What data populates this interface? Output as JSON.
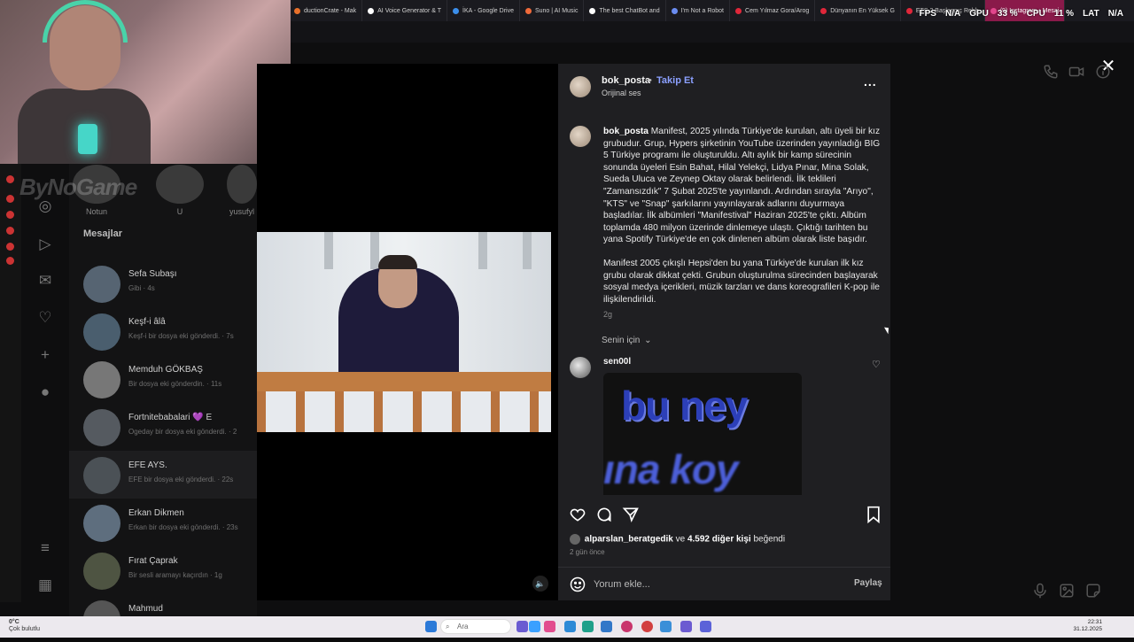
{
  "browser": {
    "tabs": [
      {
        "label": "ductionCrate - Mak",
        "color": "#e8702a"
      },
      {
        "label": "AI Voice Generator & T",
        "color": "#ffffff"
      },
      {
        "label": "İKA - Google Drive",
        "color": "#3b8eea"
      },
      {
        "label": "Suno | AI Music",
        "color": "#f06a3a"
      },
      {
        "label": "The best ChatBot and",
        "color": "#ffffff"
      },
      {
        "label": "I'm Not a Robot",
        "color": "#6a8cf0"
      },
      {
        "label": "Cem Yılmaz Gora/Arog",
        "color": "#e0273a"
      },
      {
        "label": "Dünyanın En Yüksek G",
        "color": "#e0273a"
      },
      {
        "label": "ETS 2 Başlangıç Rehb",
        "color": "#e0273a"
      },
      {
        "label": "(9) Instagram • Mesaj",
        "color": "#e2468c"
      }
    ]
  },
  "perf": {
    "fps_label": "FPS",
    "fps_value": "N/A",
    "gpu_label": "GPU",
    "gpu_value": "33 %",
    "cpu_label": "CPU",
    "cpu_value": "11 %",
    "lat_label": "LAT",
    "lat_value": "N/A"
  },
  "watermark": "ByNoGame",
  "stories": [
    {
      "name": "Notun"
    },
    {
      "name": "U"
    },
    {
      "name": "yusufyl"
    }
  ],
  "dm": {
    "title": "Mesajlar",
    "items": [
      {
        "name": "Sefa Subaşı",
        "preview": "Gibi · 4s"
      },
      {
        "name": "Keşf-i âlâ",
        "preview": "Keşf-i bir dosya eki gönderdi. · 7s"
      },
      {
        "name": "Memduh GÖKBAŞ",
        "preview": "Bir dosya eki gönderdin. · 11s"
      },
      {
        "name": "Fortnitebabalari 💜 E",
        "preview": "Ogeday bir dosya eki gönderdi. · 2"
      },
      {
        "name": "EFE AYS.",
        "preview": "EFE bir dosya eki gönderdi. · 22s"
      },
      {
        "name": "Erkan Dikmen",
        "preview": "Erkan bir dosya eki gönderdi. · 23s"
      },
      {
        "name": "Fırat Çaprak",
        "preview": "Bir sesli aramayı kaçırdın · 1g"
      },
      {
        "name": "Mahmud",
        "preview": ""
      }
    ]
  },
  "post": {
    "username": "bok_posta",
    "separator": "•",
    "follow": "Takip Et",
    "audio": "Orijinal ses",
    "more": "...",
    "caption_user": "bok_posta",
    "caption_p1": "Manifest, 2025 yılında Türkiye'de kurulan, altı üyeli bir kız grubudur. Grup, Hypers şirketinin YouTube üzerinden yayınladığı BIG 5 Türkiye programı ile oluşturuldu. Altı aylık bir kamp sürecinin sonunda üyeleri Esin Bahat, Hilal Yelekçi, Lidya Pınar, Mina Solak, Sueda Uluca ve Zeynep Oktay olarak belirlendi. İlk teklileri \"Zamansızdık\" 7 Şubat 2025'te yayınlandı. Ardından sırayla \"Arıyo\", \"KTS\" ve \"Snap\" şarkılarını yayınlayarak adlarını duyurmaya başladılar. İlk albümleri \"Manifestival\" Haziran 2025'te çıktı. Albüm toplamda 480 milyon üzerinde dinlemeye ulaştı. Çıktığı tarihten bu yana Spotify Türkiye'de en çok dinlenen albüm olarak liste başıdır.",
    "caption_p2": "Manifest 2005 çıkışlı Hepsi'den bu yana Türkiye'de kurulan ilk kız grubu olarak dikkat çekti. Grubun oluşturulma sürecinden başlayarak sosyal medya içerikleri, müzik tarzları ve dans koreografileri K-pop ile ilişkilendirildi.",
    "caption_time": "2g",
    "sort_label": "Senin için",
    "comment_user": "sen00l",
    "gif_line1": "bu ney",
    "gif_line2": "ına koy",
    "likes_user": "alparslan_beratgedik",
    "likes_and": "ve",
    "likes_count": "4.592 diğer kişi",
    "likes_suffix": "beğendi",
    "post_time": "2 gün önce",
    "comment_placeholder": "Yorum ekle...",
    "share_label": "Paylaş"
  },
  "taskbar": {
    "weather_temp": "0°C",
    "weather_desc": "Çok bulutlu",
    "search_placeholder": "Ara",
    "time": "22:31",
    "date": "31.12.2025"
  }
}
